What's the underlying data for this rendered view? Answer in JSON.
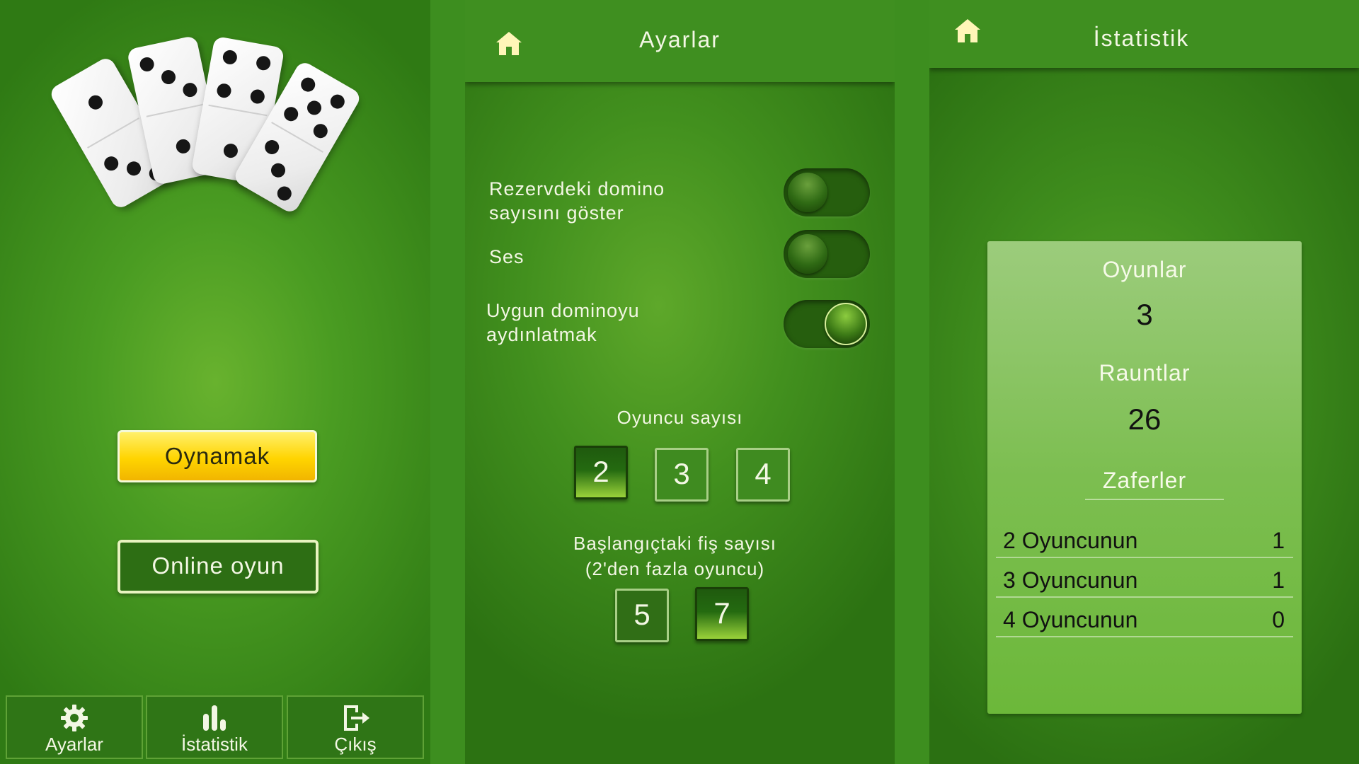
{
  "main_menu": {
    "play_label": "Oynamak",
    "online_label": "Online oyun",
    "nav": [
      {
        "label": "Ayarlar",
        "icon": "gear-icon"
      },
      {
        "label": "İstatistik",
        "icon": "bar-chart-icon"
      },
      {
        "label": "Çıkış",
        "icon": "exit-icon"
      }
    ]
  },
  "settings": {
    "title": "Ayarlar",
    "toggles": [
      {
        "label_line1": "Rezervdeki domino",
        "label_line2": "sayısını göster",
        "on": false
      },
      {
        "label_line1": "Ses",
        "label_line2": "",
        "on": false
      },
      {
        "label_line1": "Uygun dominoyu",
        "label_line2": "aydınlatmak",
        "on": true
      }
    ],
    "players_label": "Oyuncu sayısı",
    "players_options": [
      "2",
      "3",
      "4"
    ],
    "players_selected": "2",
    "tiles_label_line1": "Başlangıçtaki fiş sayısı",
    "tiles_label_line2": "(2'den fazla oyuncu)",
    "tiles_options": [
      "5",
      "7"
    ],
    "tiles_selected": "7"
  },
  "stats": {
    "title": "İstatistik",
    "games_label": "Oyunlar",
    "games_value": "3",
    "rounds_label": "Rauntlar",
    "rounds_value": "26",
    "wins_label": "Zaferler",
    "wins_rows": [
      {
        "label": "2 Oyuncunun",
        "value": "1"
      },
      {
        "label": "3 Oyuncunun",
        "value": "1"
      },
      {
        "label": "4 Oyuncunun",
        "value": "0"
      }
    ]
  },
  "colors": {
    "accent_yellow": "#ffd400",
    "dark_green": "#2d6e14",
    "bg_green": "#4a9c22"
  }
}
